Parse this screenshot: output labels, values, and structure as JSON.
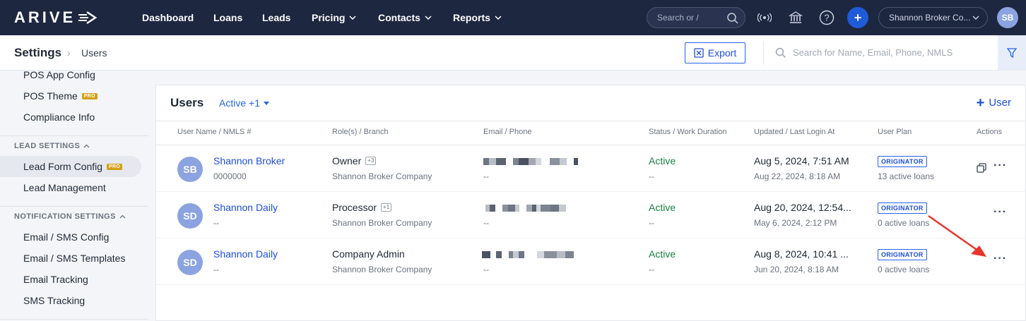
{
  "app": {
    "logo_text": "ARIVE"
  },
  "topnav": {
    "items": [
      "Dashboard",
      "Loans",
      "Leads",
      "Pricing",
      "Contacts",
      "Reports"
    ],
    "search_placeholder": "Search or /",
    "company": "Shannon Broker Co...",
    "avatar_initials": "SB"
  },
  "subheader": {
    "title": "Settings",
    "page": "Users",
    "export_label": "Export",
    "search_placeholder": "Search for Name, Email, Phone, NMLS"
  },
  "sidebar": {
    "top_items": [
      {
        "label": "POS App Config",
        "pro": false
      },
      {
        "label": "POS Theme",
        "pro": true
      },
      {
        "label": "Compliance Info",
        "pro": false
      }
    ],
    "lead_section": "LEAD SETTINGS",
    "lead_items": [
      {
        "label": "Lead Form Config",
        "pro": true,
        "active": true
      },
      {
        "label": "Lead Management",
        "pro": false
      }
    ],
    "notification_section": "NOTIFICATION SETTINGS",
    "notification_items": [
      {
        "label": "Email / SMS Config"
      },
      {
        "label": "Email / SMS Templates"
      },
      {
        "label": "Email Tracking"
      },
      {
        "label": "SMS Tracking"
      }
    ],
    "pro_badge": "PRO"
  },
  "users": {
    "title": "Users",
    "filter_label": "Active +1",
    "add_label": "User",
    "columns": [
      "User Name / NMLS #",
      "Role(s) / Branch",
      "Email / Phone",
      "Status / Work Duration",
      "Updated / Last Login At",
      "User Plan",
      "Actions"
    ],
    "rows": [
      {
        "initials": "SB",
        "name": "Shannon Broker",
        "nmls": "0000000",
        "role": "Owner",
        "role_extra": "+3",
        "branch": "Shannon Broker Company",
        "phone": "--",
        "status": "Active",
        "duration": "--",
        "updated": "Aug 5, 2024, 7:51 AM",
        "last_login": "Aug 22, 2024, 8:18 AM",
        "plan": "ORIGINATOR",
        "loans": "13 active loans",
        "has_copy": true
      },
      {
        "initials": "SD",
        "name": "Shannon Daily",
        "nmls": "--",
        "role": "Processor",
        "role_extra": "+1",
        "branch": "Shannon Broker Company",
        "phone": "--",
        "status": "Active",
        "duration": "--",
        "updated": "Aug 20, 2024, 12:54...",
        "last_login": "May 6, 2024, 2:12 PM",
        "plan": "ORIGINATOR",
        "loans": "0 active loans",
        "has_copy": false
      },
      {
        "initials": "SD",
        "name": "Shannon Daily",
        "nmls": "--",
        "role": "Company Admin",
        "role_extra": "",
        "branch": "Shannon Broker Company",
        "phone": "--",
        "status": "Active",
        "duration": "--",
        "updated": "Aug 8, 2024, 10:41 ...",
        "last_login": "Jun 20, 2024, 8:18 AM",
        "plan": "ORIGINATOR",
        "loans": "0 active loans",
        "has_copy": false
      }
    ],
    "more_label": "···"
  },
  "colors": {
    "nav_bg": "#1e2740",
    "accent": "#2563eb",
    "status_active": "#15803d",
    "annotation_arrow": "#e8352b"
  }
}
